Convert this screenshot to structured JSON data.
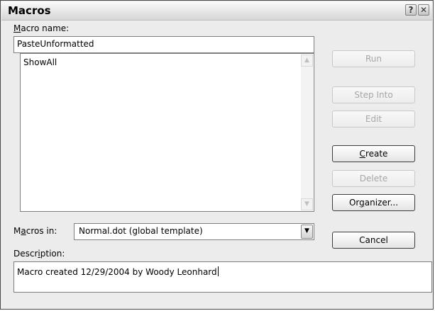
{
  "window": {
    "title": "Macros",
    "help_glyph": "?",
    "close_glyph": "✕"
  },
  "macro_name": {
    "label_mnemonic": "M",
    "label_rest": "acro name:",
    "value": "PasteUnformatted"
  },
  "macro_list": {
    "items": [
      "ShowAll"
    ],
    "scroll_up_glyph": "▲",
    "scroll_down_glyph": "▼"
  },
  "buttons": {
    "run": "Run",
    "step_into": "Step Into",
    "edit": "Edit",
    "create_mnemonic": "C",
    "create_rest": "reate",
    "delete": "Delete",
    "organizer_pre": "Or",
    "organizer_mnemonic": "g",
    "organizer_rest": "anizer...",
    "cancel": "Cancel"
  },
  "macros_in": {
    "label_pre": "M",
    "label_mnemonic": "a",
    "label_rest": "cros in:",
    "selected": "Normal.dot (global template)",
    "dropdown_glyph": "▼"
  },
  "description": {
    "label_pre": "Descr",
    "label_mnemonic": "i",
    "label_rest": "ption:",
    "value": "Macro created 12/29/2004 by Woody Leonhard"
  }
}
